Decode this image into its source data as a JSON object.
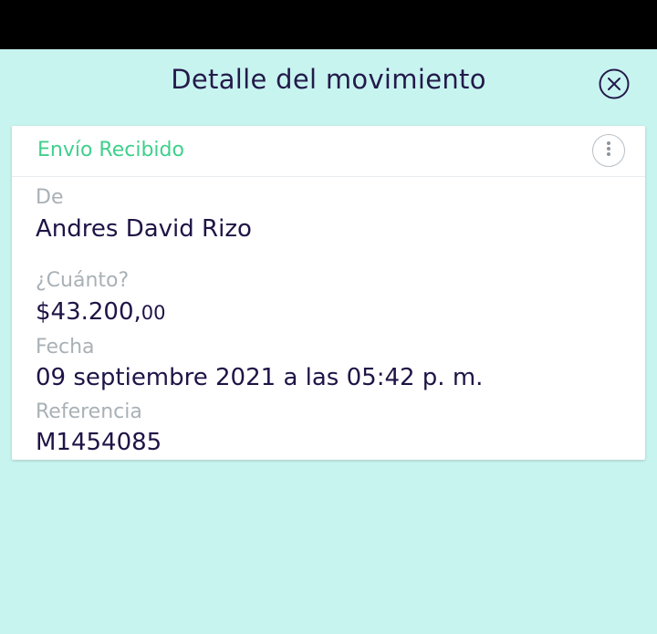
{
  "header": {
    "title": "Detalle del movimiento",
    "close_icon": "close-circle-icon"
  },
  "card": {
    "status": "Envío Recibido",
    "status_color": "#3fd08c",
    "more_icon": "more-vertical-icon",
    "fields": {
      "from_label": "De",
      "from_value": "Andres David Rizo",
      "amount_label": "¿Cuánto?",
      "amount_main": "$43.200,",
      "amount_cents": "00",
      "date_label": "Fecha",
      "date_value": "09 septiembre 2021 a las 05:42 p. m.",
      "reference_label": "Referencia",
      "reference_value": "M1454085"
    }
  },
  "colors": {
    "background": "#c8f4f0",
    "text_primary": "#1f1446",
    "text_muted": "#a9b1b6"
  }
}
